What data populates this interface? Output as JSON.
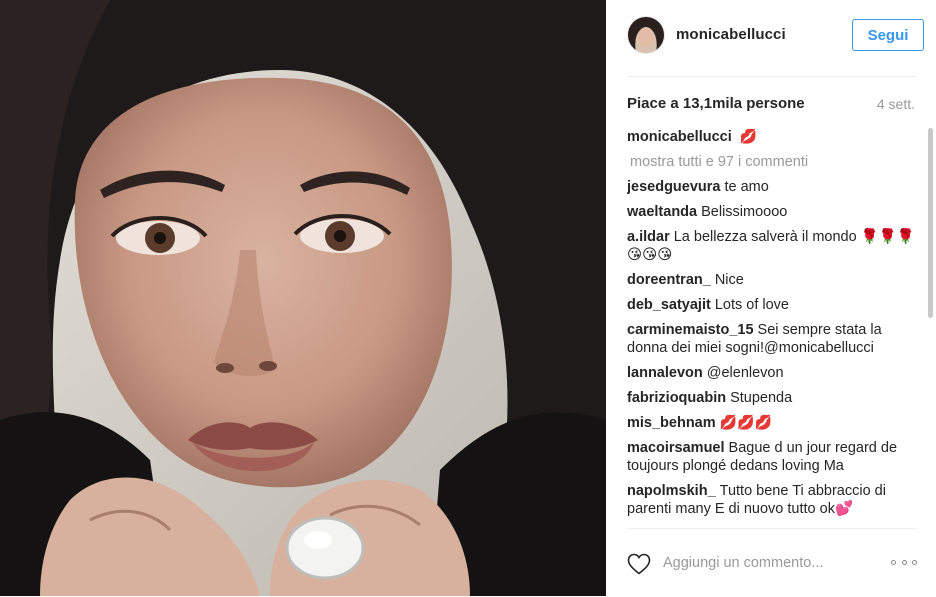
{
  "post": {
    "username": "monicabellucci",
    "follow_label": "Segui",
    "likes_text": "Piace a 13,1mila persone",
    "age": "4 sett.",
    "caption": {
      "user": "monicabellucci",
      "text": "💋"
    },
    "show_all_label": "mostra tutti e 97 i commenti",
    "comments": [
      {
        "user": "jesedguevura",
        "text": "te amo"
      },
      {
        "user": "waeltanda",
        "text": "Belissimoooo"
      },
      {
        "user": "a.ildar",
        "text": "La bellezza salverà il mondo 🌹🌹🌹😘😘😘"
      },
      {
        "user": "doreentran_",
        "text": "Nice"
      },
      {
        "user": "deb_satyajit",
        "text": "Lots of love"
      },
      {
        "user": "carminemaisto_15",
        "text": "Sei sempre stata la donna dei miei sogni!@monicabellucci"
      },
      {
        "user": "lannalevon",
        "text": "@elenlevon"
      },
      {
        "user": "fabrizioquabin",
        "text": "Stupenda"
      },
      {
        "user": "mis_behnam",
        "text": "💋💋💋"
      },
      {
        "user": "macoirsamuel",
        "text": "Bague d un jour regard de toujours plongé dedans loving Ma"
      },
      {
        "user": "napolmskih_",
        "text": "Tutto bene Ti abbraccio di parenti many E di nuovo tutto ok💕"
      }
    ],
    "add_comment_placeholder": "Aggiungi un commento...",
    "icons": {
      "like": "heart-outline-icon",
      "more": "three-dots-icon"
    },
    "colors": {
      "accent": "#3897f0",
      "muted": "#999999",
      "text": "#262626"
    }
  }
}
